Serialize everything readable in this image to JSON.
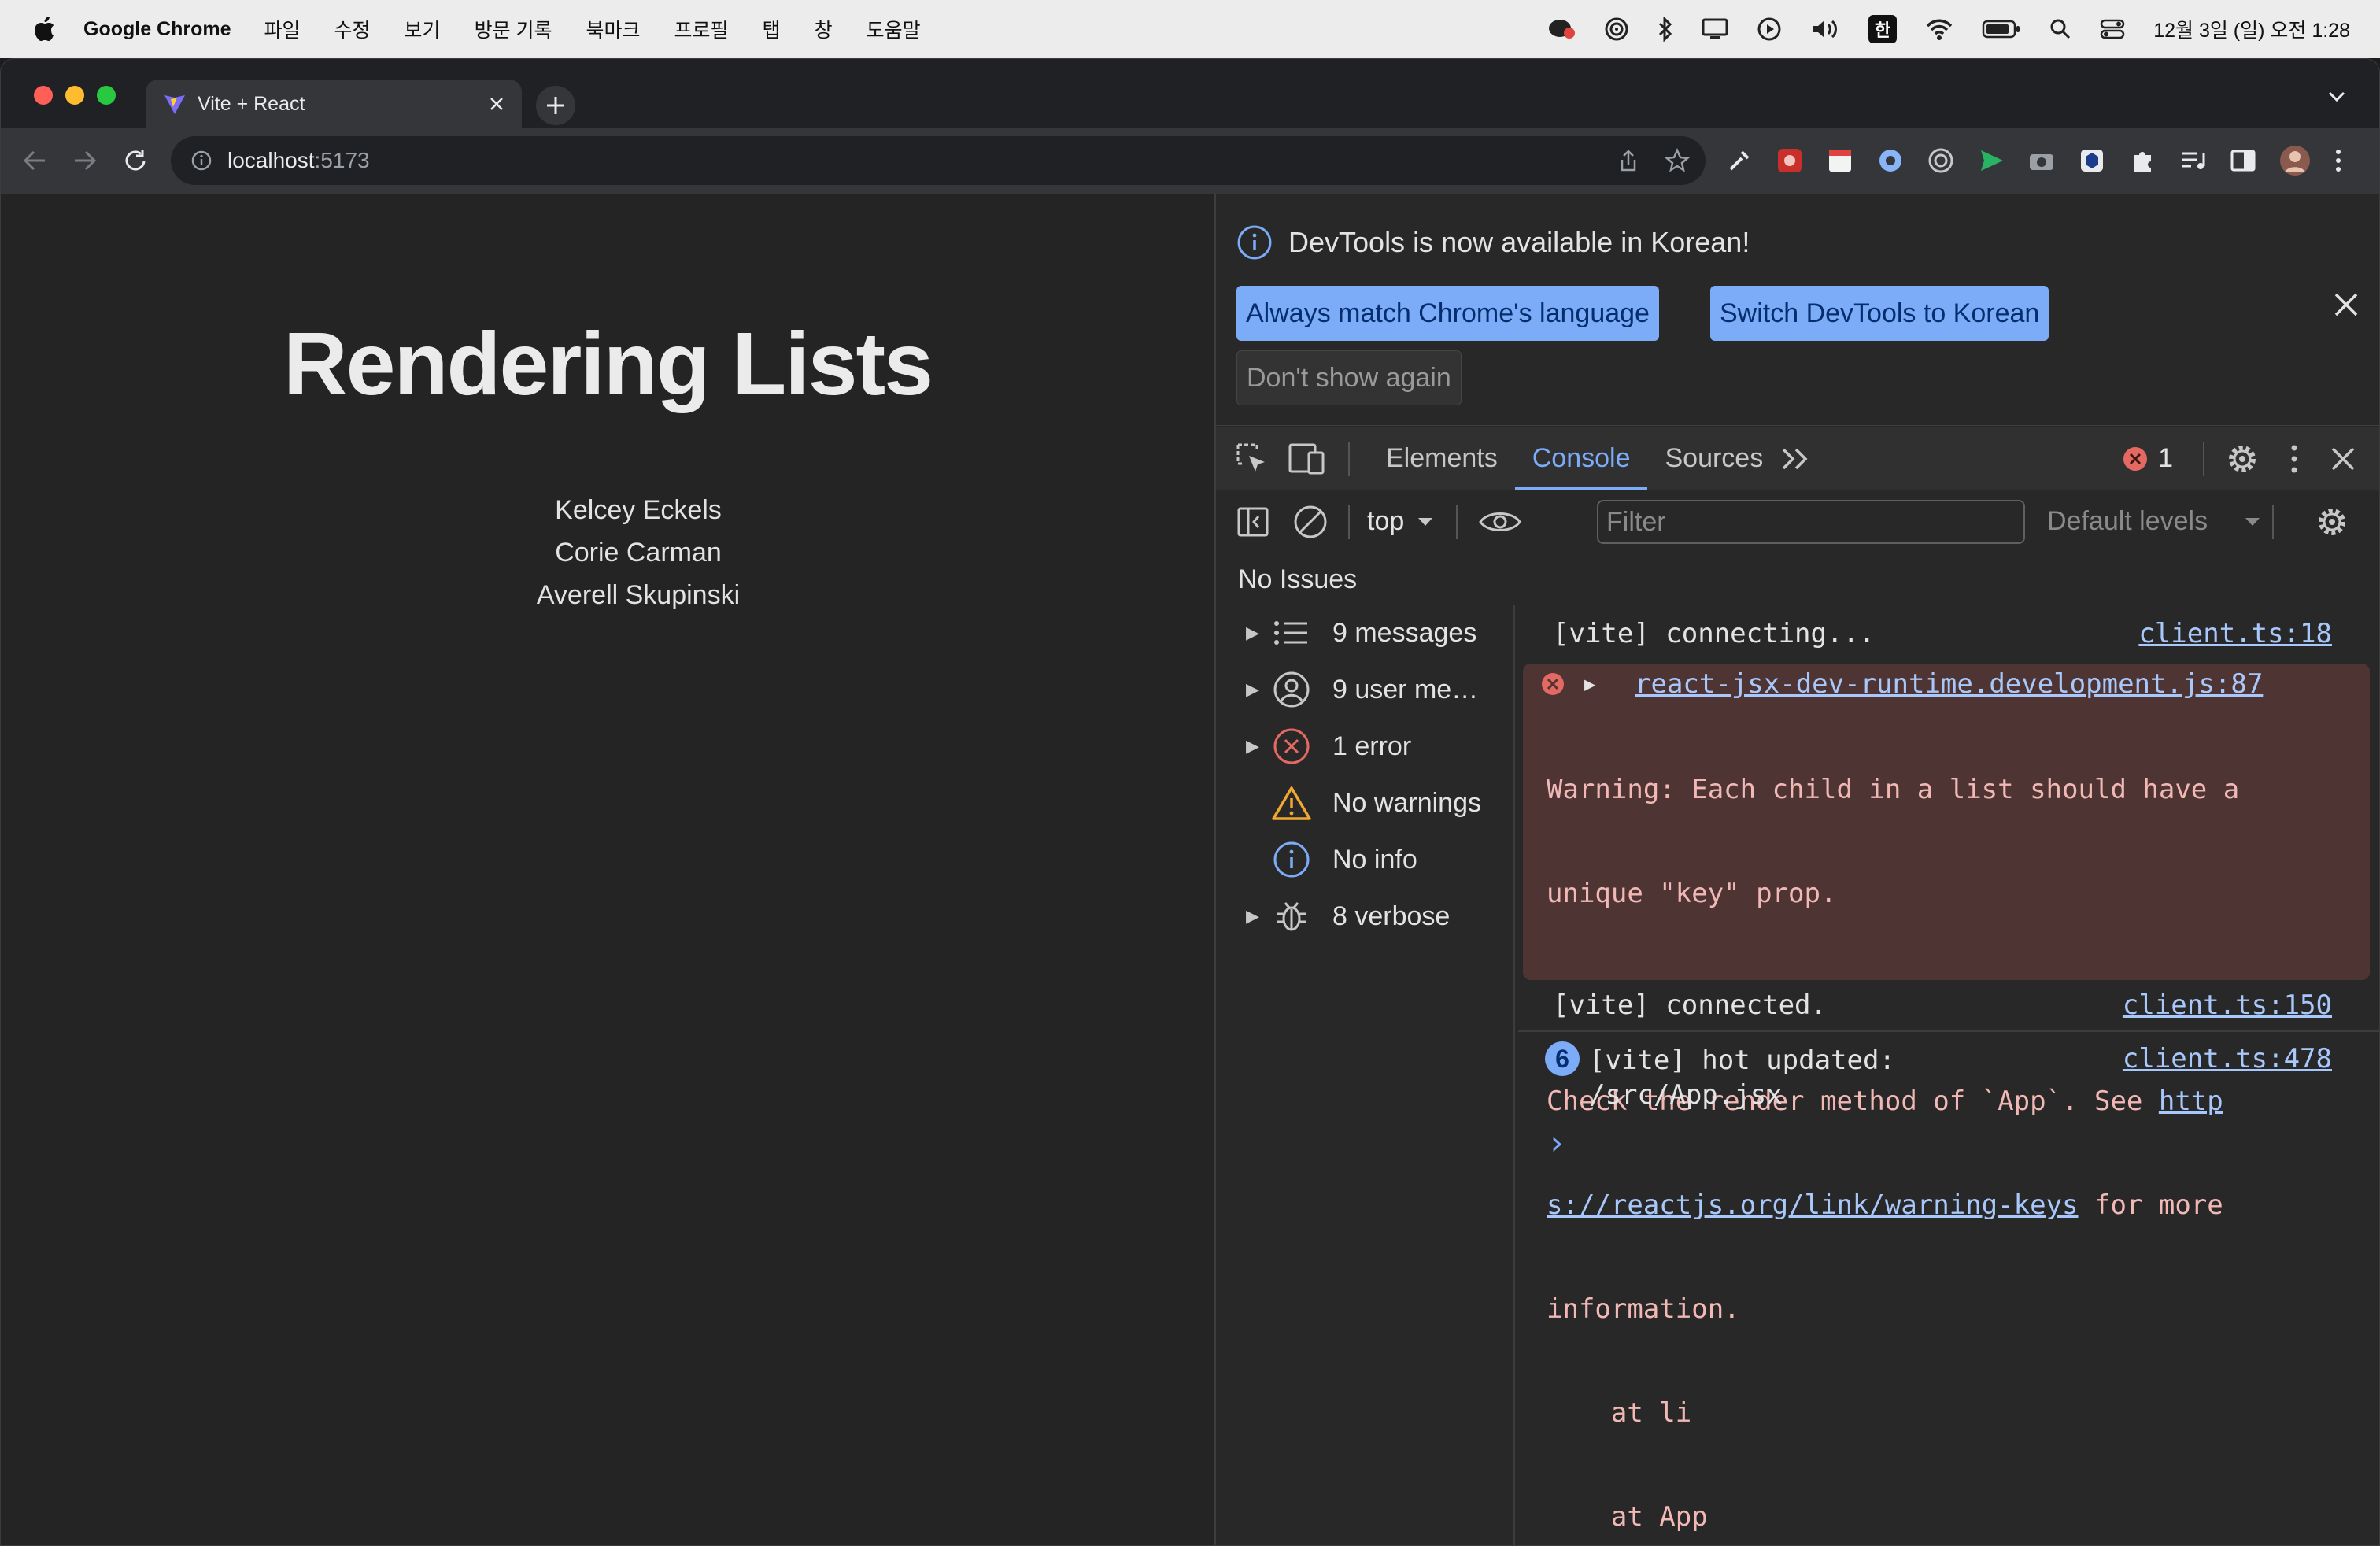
{
  "menubar": {
    "app_name": "Google Chrome",
    "items": [
      "파일",
      "수정",
      "보기",
      "방문 기록",
      "북마크",
      "프로필",
      "탭",
      "창",
      "도움말"
    ],
    "input_source": "한",
    "datetime": "12월 3일 (일) 오전 1:28"
  },
  "browser": {
    "tab_title": "Vite + React",
    "url_host": "localhost",
    "url_port": ":5173"
  },
  "page": {
    "heading": "Rendering Lists",
    "people": [
      "Kelcey Eckels",
      "Corie Carman",
      "Averell Skupinski"
    ]
  },
  "devtools": {
    "infobar": {
      "message": "DevTools is now available in Korean!",
      "btn_match": "Always match Chrome's language",
      "btn_switch": "Switch DevTools to Korean",
      "btn_dont_show": "Don't show again"
    },
    "tabs": {
      "elements": "Elements",
      "console": "Console",
      "sources": "Sources"
    },
    "error_count": "1",
    "toolbar": {
      "context": "top",
      "filter_placeholder": "Filter",
      "levels": "Default levels"
    },
    "issues": "No Issues",
    "sidebar": {
      "messages": "9 messages",
      "user_messages": "9 user me…",
      "errors": "1 error",
      "warnings": "No warnings",
      "info": "No info",
      "verbose": "8 verbose"
    },
    "console": {
      "connecting": {
        "text": "[vite] connecting...",
        "source": "client.ts:18"
      },
      "error": {
        "source": "react-jsx-dev-runtime.development.js:87",
        "line1": "Warning: Each child in a list should have a",
        "line2": "unique \"key\" prop.",
        "line3a": "Check the render method of `App`. See ",
        "link_a": "http",
        "link_b": "s://reactjs.org/link/warning-keys",
        "line4b": " for more",
        "line5": "information.",
        "line6": "    at li",
        "line7": "    at App"
      },
      "connected": {
        "text": "[vite] connected.",
        "source": "client.ts:150"
      },
      "hot": {
        "count": "6",
        "line1": "[vite] hot updated:",
        "line2": "/src/App.jsx",
        "source": "client.ts:478"
      },
      "prompt": "›"
    }
  }
}
